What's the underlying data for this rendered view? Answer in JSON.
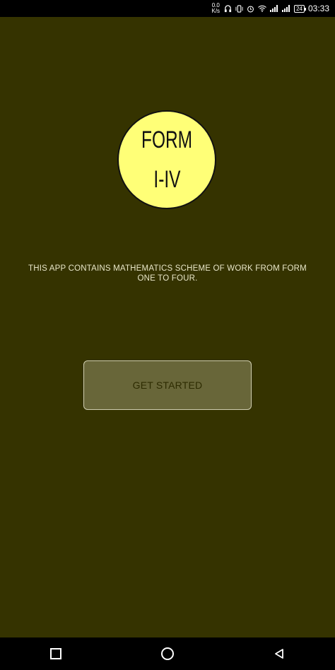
{
  "status_bar": {
    "net_speed_value": "0.0",
    "net_speed_unit": "K/s",
    "battery": "24",
    "time": "03:33",
    "icons": [
      "headset-icon",
      "vibrate-icon",
      "alarm-icon",
      "wifi-icon",
      "signal-icon",
      "signal-icon",
      "battery-icon"
    ]
  },
  "logo": {
    "line1": "FORM",
    "line2": "I-IV",
    "fill_color": "#ffff77"
  },
  "description": "THIS APP CONTAINS MATHEMATICS SCHEME OF WORK FROM FORM ONE TO FOUR.",
  "get_started_label": "GET STARTED",
  "colors": {
    "background": "#353300",
    "button": "#686639"
  },
  "nav_bar": {
    "icons": [
      "recents-square-icon",
      "home-circle-icon",
      "back-triangle-icon"
    ]
  }
}
